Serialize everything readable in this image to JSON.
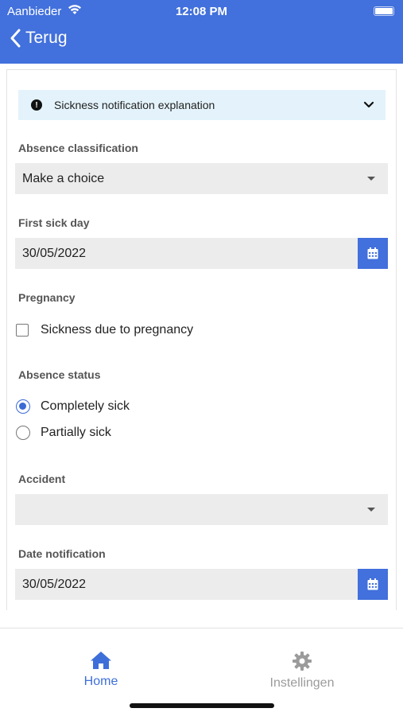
{
  "status_bar": {
    "carrier": "Aanbieder",
    "time": "12:08 PM"
  },
  "nav": {
    "back_label": "Terug"
  },
  "info": {
    "text": "Sickness notification explanation"
  },
  "form": {
    "absence_classification": {
      "label": "Absence classification",
      "value": "Make a choice"
    },
    "first_sick_day": {
      "label": "First sick day",
      "value": "30/05/2022"
    },
    "pregnancy": {
      "label": "Pregnancy",
      "checkbox_label": "Sickness due to pregnancy",
      "checked": false
    },
    "absence_status": {
      "label": "Absence status",
      "options": [
        {
          "label": "Completely sick",
          "selected": true
        },
        {
          "label": "Partially sick",
          "selected": false
        }
      ]
    },
    "accident": {
      "label": "Accident",
      "value": ""
    },
    "date_notification": {
      "label": "Date notification",
      "value": "30/05/2022"
    }
  },
  "tabs": [
    {
      "label": "Home",
      "icon": "home-icon",
      "active": true
    },
    {
      "label": "Instellingen",
      "icon": "gear-icon",
      "active": false
    }
  ],
  "colors": {
    "primary": "#4270dc",
    "info_bg": "#e4f3fb",
    "field_bg": "#ececec",
    "inactive_tab": "#9b9b9b"
  }
}
